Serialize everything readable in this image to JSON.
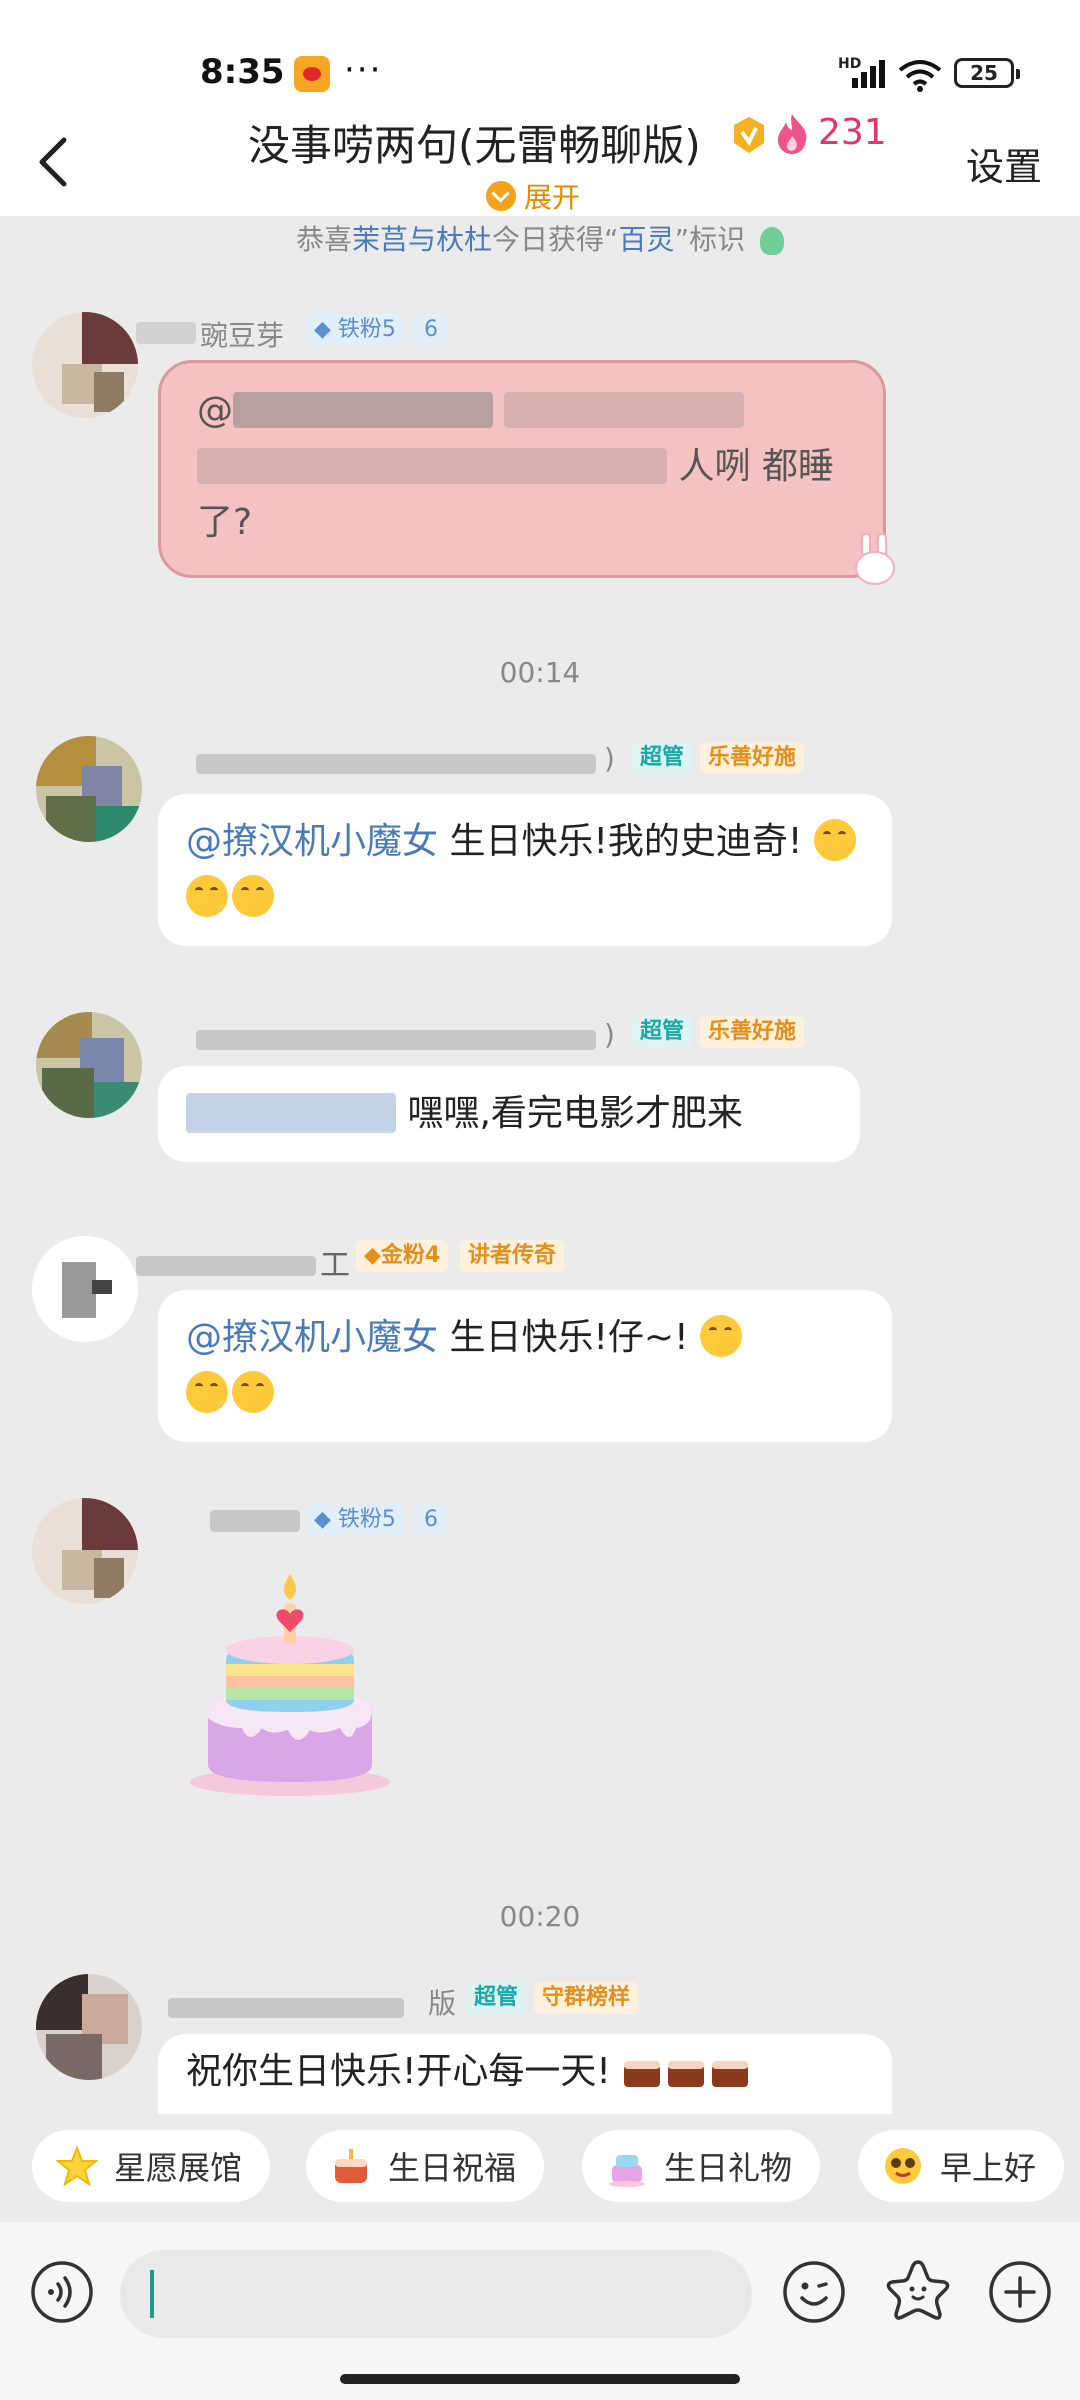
{
  "status_bar": {
    "time": "8:35",
    "more": "···",
    "network": "HD",
    "battery": "25"
  },
  "header": {
    "title": "没事唠两句(无雷畅聊版)",
    "fire_count": "231",
    "settings_label": "设置",
    "expand_label": "展开"
  },
  "notice": {
    "prefix": "恭喜",
    "users": "茉莒与杕杜",
    "middle": "今日获得",
    "title_open": "“",
    "title": "百灵",
    "title_close": "”",
    "suffix": "标识"
  },
  "messages": [
    {
      "name_visible": "豌豆芽",
      "fan_badge": "铁粉5",
      "level": "6",
      "text_end": "人咧 都睡了?"
    },
    {
      "time": "00:14"
    },
    {
      "admin_tag": "超管",
      "honor_tag": "乐善好施",
      "mention": "@撩汉机小魔女",
      "text": "生日快乐!我的史迪奇!"
    },
    {
      "admin_tag": "超管",
      "honor_tag": "乐善好施",
      "text": "嘿嘿,看完电影才肥来"
    },
    {
      "name_visible": "工",
      "fan_badge": "金粉4",
      "honor_tag": "讲者传奇",
      "mention": "@撩汉机小魔女",
      "text": "生日快乐!仔~!"
    },
    {
      "fan_badge": "铁粉5",
      "level": "6",
      "sticker": "cake"
    },
    {
      "time": "00:20"
    },
    {
      "name_visible": "版",
      "admin_tag": "超管",
      "honor_tag": "守群榜样",
      "text": "祝你生日快乐!开心每一天!"
    }
  ],
  "quick_replies": [
    {
      "label": "星愿展馆",
      "icon": "star-icon"
    },
    {
      "label": "生日祝福",
      "icon": "cake-icon"
    },
    {
      "label": "生日礼物",
      "icon": "gift-cake-icon"
    },
    {
      "label": "早上好",
      "icon": "sun-face-icon"
    }
  ],
  "colors": {
    "accent": "#4a7ab8",
    "fire": "#e8336a",
    "admin_tag": "#19a8a8",
    "honor_tag": "#e58f1a",
    "caret": "#1a9b8b"
  }
}
